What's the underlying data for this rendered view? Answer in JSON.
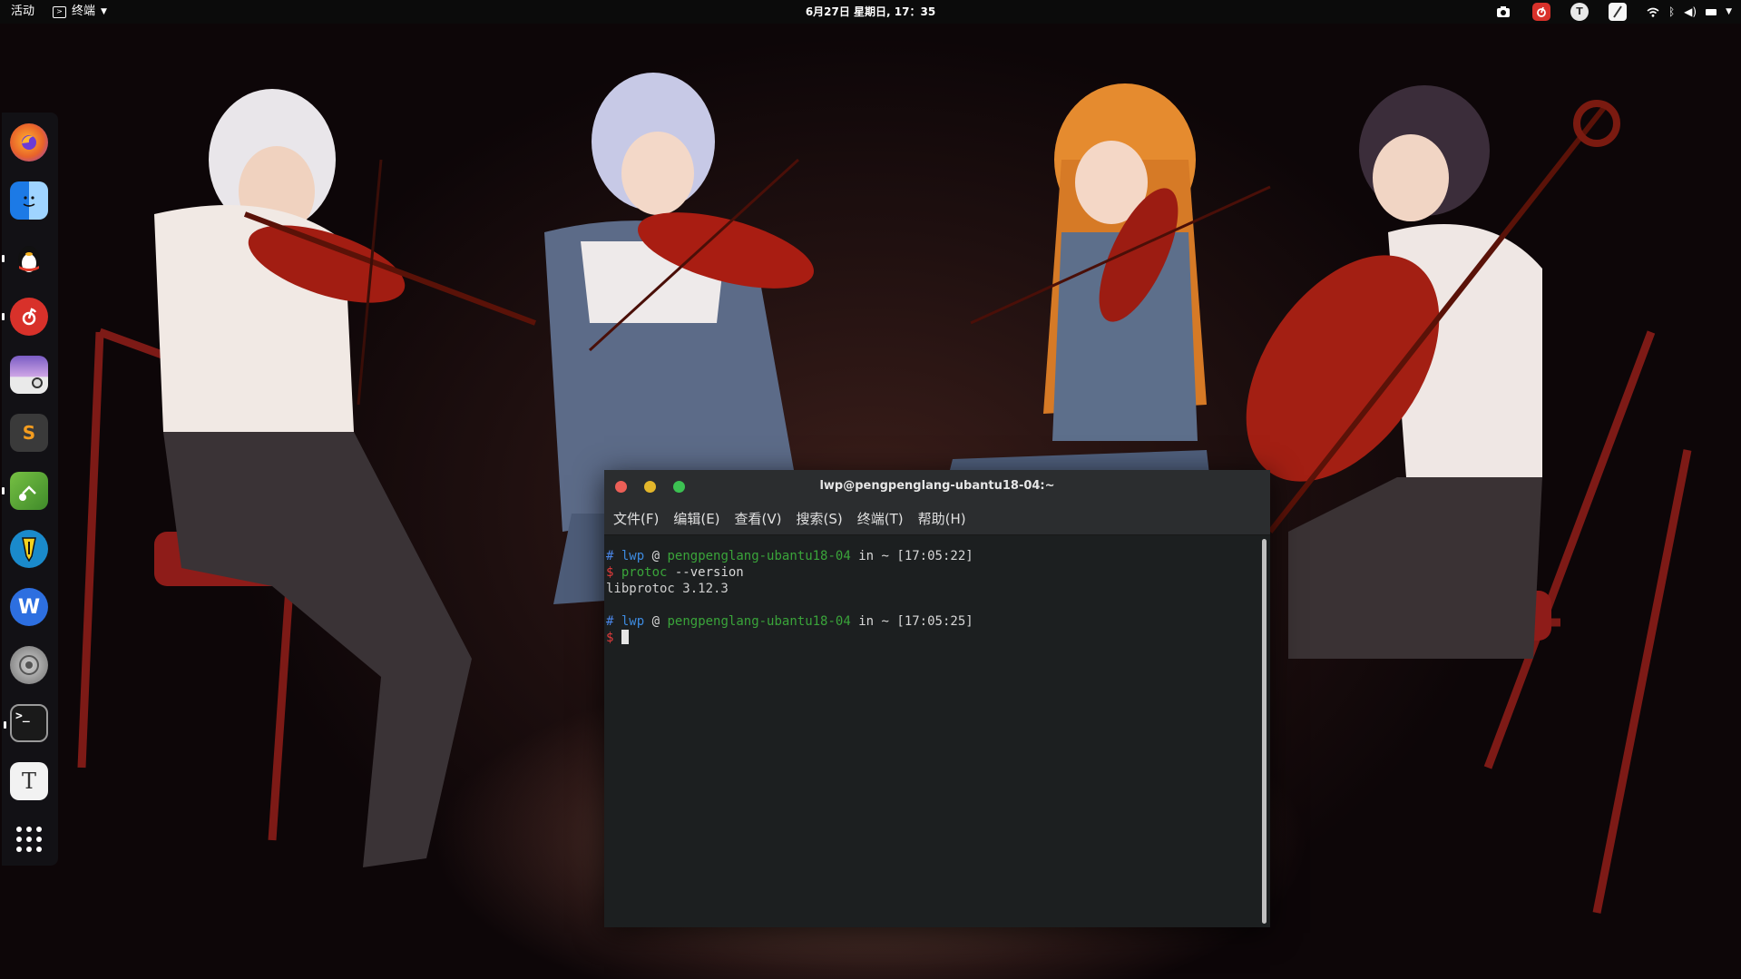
{
  "topbar": {
    "activities": "活动",
    "app_menu": "终端",
    "clock": "6月27日 星期日, 17：35",
    "tray_icons": [
      "camera-icon",
      "netease-music-icon",
      "typora-icon",
      "notes-icon",
      "wifi-icon",
      "bluetooth-icon",
      "volume-icon",
      "battery-icon",
      "chevron-down-icon"
    ]
  },
  "dock": {
    "items": [
      {
        "name": "firefox-icon",
        "color": "#e8632a"
      },
      {
        "name": "finder-icon",
        "color": "#3aa0f0"
      },
      {
        "name": "qq-penguin-icon",
        "color": "#111111"
      },
      {
        "name": "netease-music-icon",
        "color": "#d8312a"
      },
      {
        "name": "image-viewer-icon",
        "color": "#8a6cc8"
      },
      {
        "name": "sublime-text-icon",
        "color": "#e88a1a"
      },
      {
        "name": "nvidia-sync-icon",
        "color": "#59a83a"
      },
      {
        "name": "pen-app-icon",
        "color": "#1a8acb"
      },
      {
        "name": "wps-writer-icon",
        "color": "#2d6fe0"
      },
      {
        "name": "system-settings-icon",
        "color": "#8c8c8c"
      },
      {
        "name": "terminal-icon",
        "color": "#2a2a2a"
      },
      {
        "name": "typora-icon",
        "color": "#f2f2f2"
      },
      {
        "name": "show-apps-icon",
        "color": "transparent"
      }
    ],
    "terminal_glyph": ">_",
    "typora_glyph": "T",
    "sublime_glyph": "S",
    "wps_glyph": "W"
  },
  "terminal": {
    "title": "lwp@pengpenglang-ubantu18-04:~",
    "menu": [
      "文件(F)",
      "编辑(E)",
      "查看(V)",
      "搜索(S)",
      "终端(T)",
      "帮助(H)"
    ],
    "lines": [
      {
        "hash": "#",
        "user": "lwp",
        "at": "@",
        "host": "pengpenglang-ubantu18-04",
        "in": "in",
        "dir": "~",
        "time": "[17:05:22]"
      },
      {
        "dollar": "$",
        "cmd": "protoc",
        "args": " --version"
      },
      {
        "output": "libprotoc 3.12.3"
      },
      {
        "hash": "#",
        "user": "lwp",
        "at": "@",
        "host": "pengpenglang-ubantu18-04",
        "in": "in",
        "dir": "~",
        "time": "[17:05:25]"
      },
      {
        "dollar": "$"
      }
    ]
  }
}
